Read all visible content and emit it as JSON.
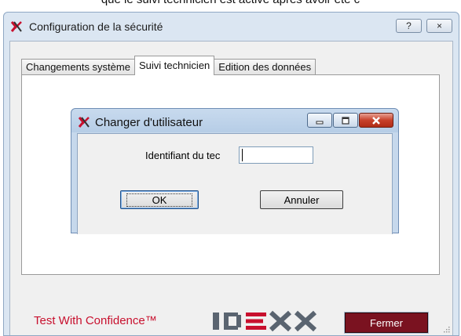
{
  "top_text": "que le suivi technicien est activé après avoir été c",
  "outer_window": {
    "title": "Configuration de la sécurité",
    "help_button": "?",
    "close_button": "×"
  },
  "tabs": [
    {
      "label": "Changements système",
      "active": false
    },
    {
      "label": "Suivi technicien",
      "active": true
    },
    {
      "label": "Edition des données",
      "active": false
    }
  ],
  "dialog": {
    "title": "Changer d'utilisateur",
    "field_label": "Identifiant du tec",
    "field_value": "",
    "ok_label": "OK",
    "cancel_label": "Annuler"
  },
  "footer": {
    "tagline": "Test With Confidence™",
    "logo_name": "idexx-logo",
    "close_label": "Fermer"
  },
  "colors": {
    "brand_red": "#c8102e",
    "close_button_bg": "#7a1220"
  }
}
